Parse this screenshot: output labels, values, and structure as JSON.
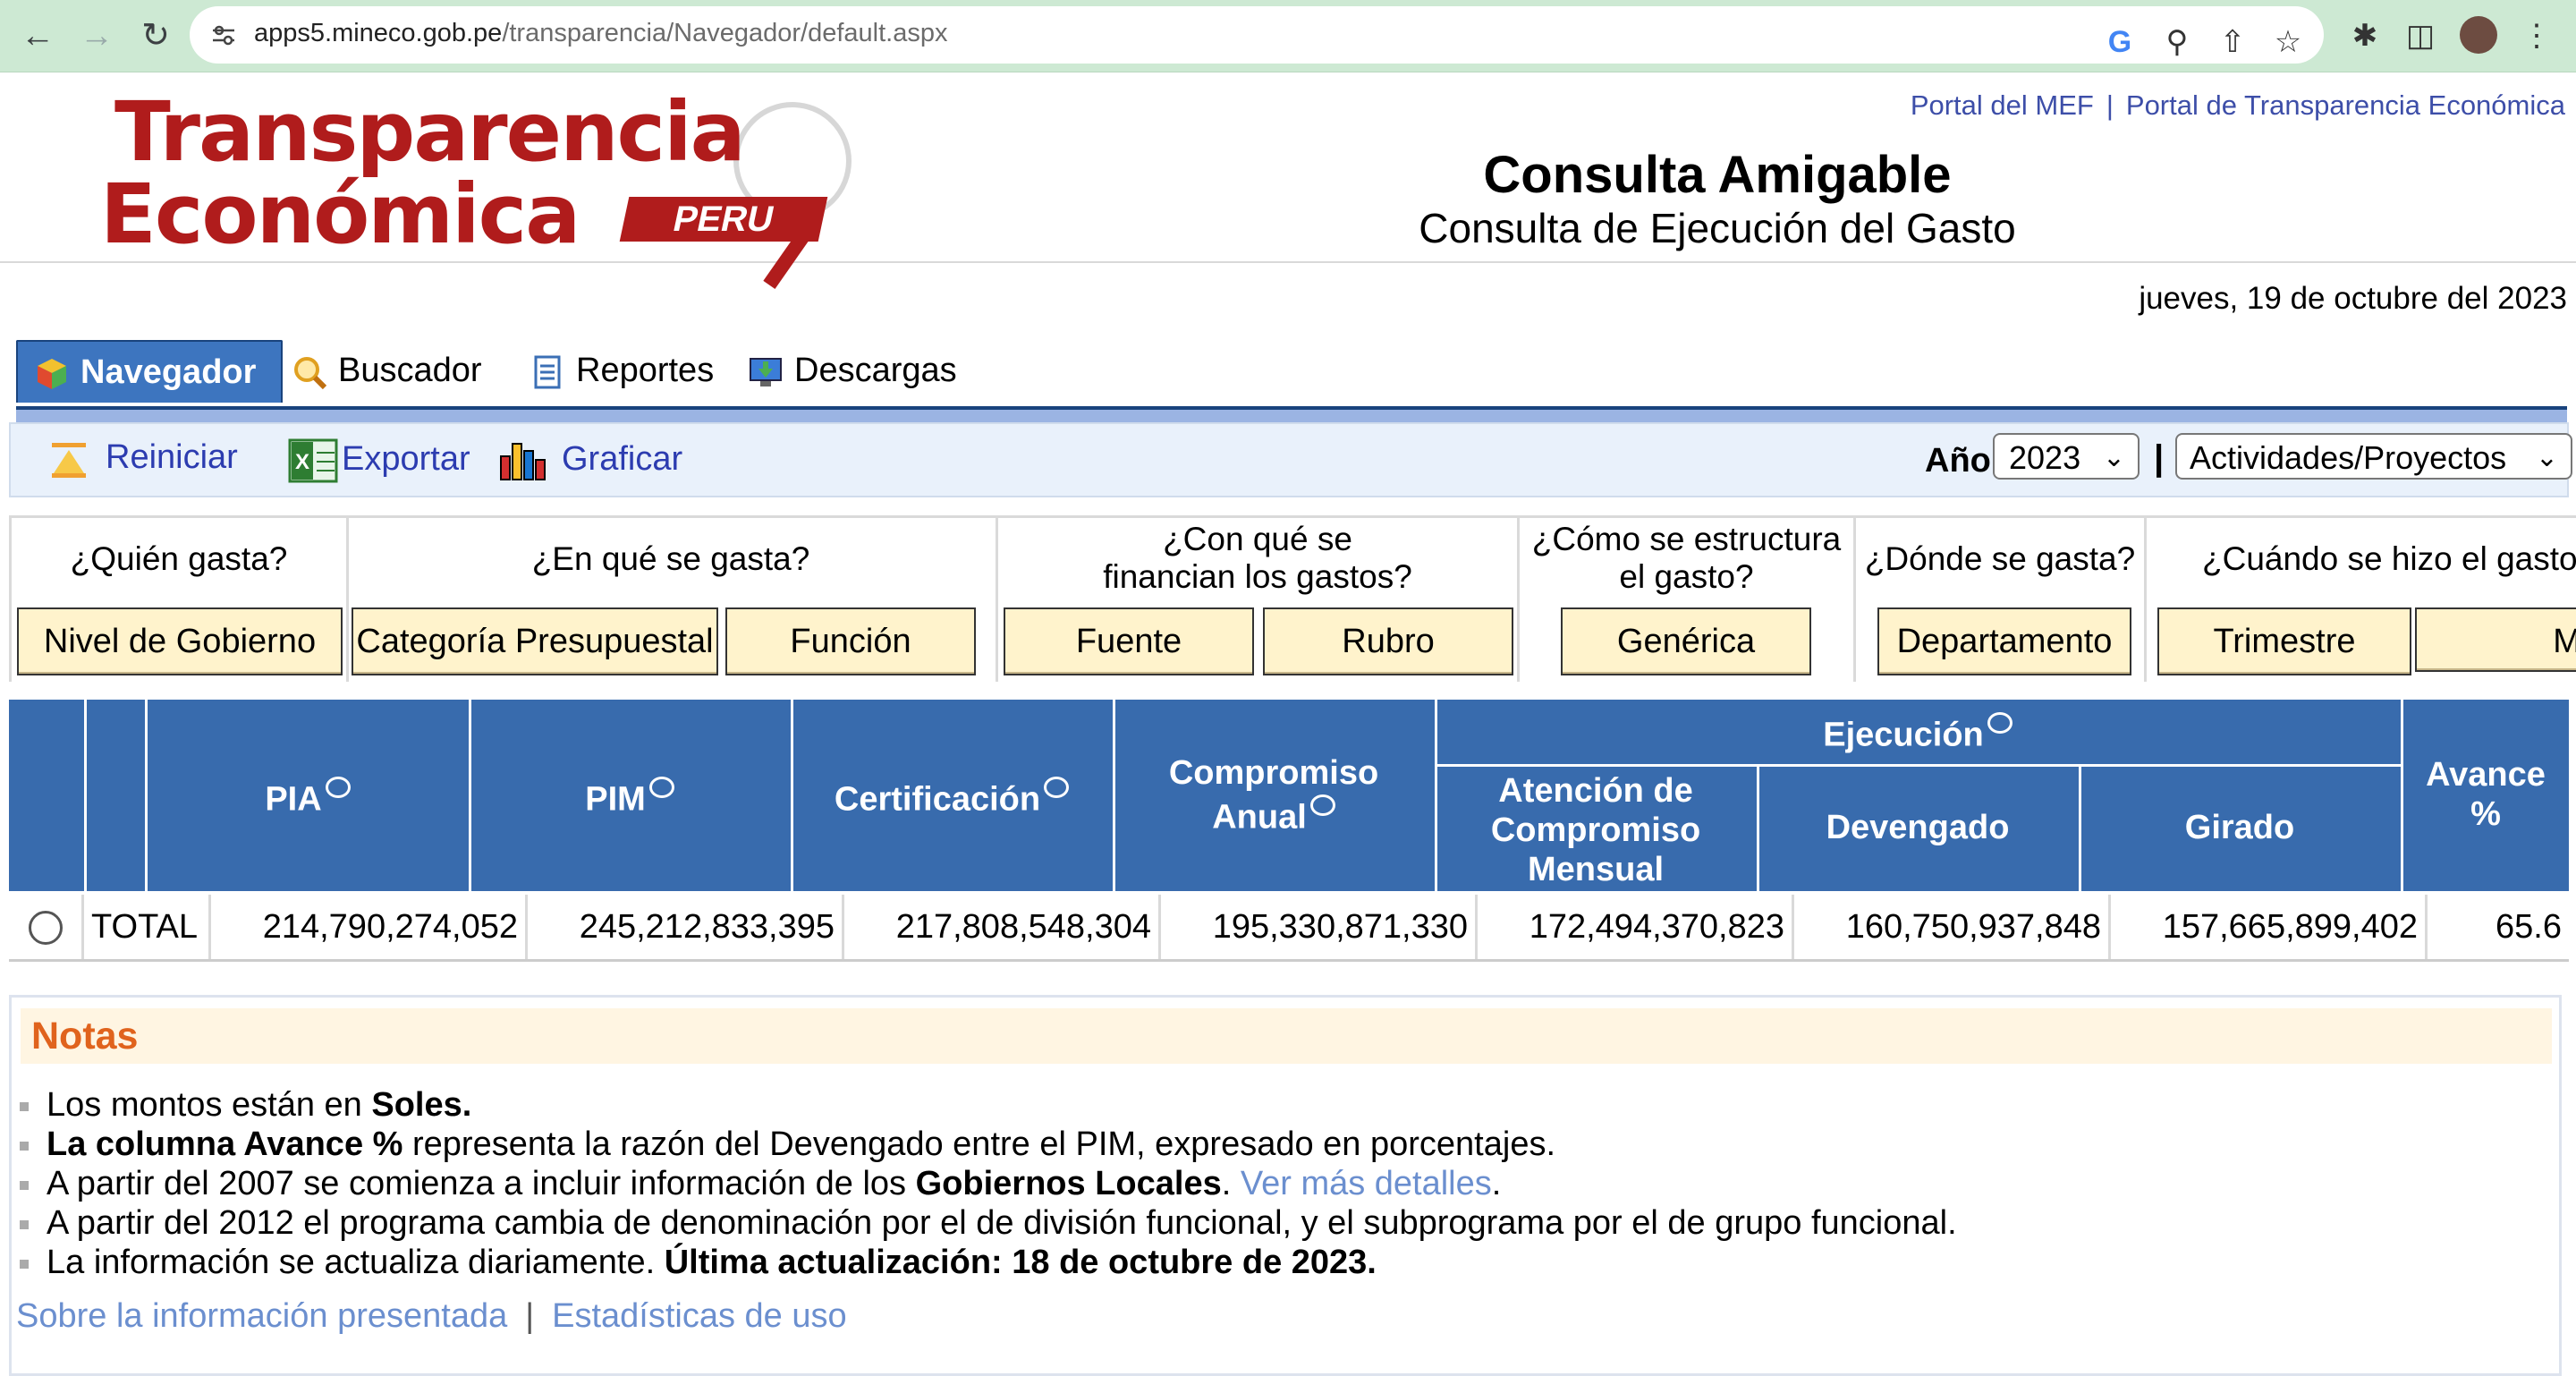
{
  "browser": {
    "url_domain": "apps5.mineco.gob.pe",
    "url_path": "/transparencia/Navegador/default.aspx"
  },
  "header": {
    "logo_line1": "Transparencia",
    "logo_line2": "Económica",
    "logo_peru": "PERU",
    "link_mef": "Portal del MEF",
    "link_sep": "|",
    "link_transparencia": "Portal de Transparencia Económica",
    "title": "Consulta Amigable",
    "subtitle": "Consulta de Ejecución del Gasto"
  },
  "date": "jueves, 19 de octubre del 2023",
  "tabs": [
    {
      "label": "Navegador",
      "icon": "cube-icon"
    },
    {
      "label": "Buscador",
      "icon": "magnifier-icon"
    },
    {
      "label": "Reportes",
      "icon": "report-icon"
    },
    {
      "label": "Descargas",
      "icon": "download-icon"
    }
  ],
  "toolbar": {
    "reset_label": "Reiniciar",
    "export_label": "Exportar",
    "chart_label": "Graficar",
    "year_label": "Año",
    "year_value": "2023",
    "pipe": "|",
    "type_value": "Actividades/Proyectos"
  },
  "questions": {
    "who": "¿Quién gasta?",
    "what": "¿En qué se gasta?",
    "funding_line1": "¿Con qué se",
    "funding_line2": "financian los gastos?",
    "structure_line1": "¿Cómo se estructura",
    "structure_line2": "el gasto?",
    "where": "¿Dónde se gasta?",
    "when": "¿Cuándo se hizo el gasto?",
    "btn_nivel": "Nivel de Gobierno",
    "btn_categoria": "Categoría Presupuestal",
    "btn_funcion": "Función",
    "btn_fuente": "Fuente",
    "btn_rubro": "Rubro",
    "btn_generica": "Genérica",
    "btn_departamento": "Departamento",
    "btn_trimestre": "Trimestre",
    "btn_mes": "Mes"
  },
  "table": {
    "headers": {
      "pia": "PIA",
      "pim": "PIM",
      "certificacion": "Certificación",
      "compromiso_line1": "Compromiso",
      "compromiso_line2": "Anual",
      "ejecucion": "Ejecución",
      "atencion_line1": "Atención de",
      "atencion_line2": "Compromiso",
      "atencion_line3": "Mensual",
      "devengado": "Devengado",
      "girado": "Girado",
      "avance_line1": "Avance",
      "avance_line2": "%"
    },
    "row": {
      "label": "TOTAL",
      "pia": "214,790,274,052",
      "pim": "245,212,833,395",
      "certificacion": "217,808,548,304",
      "compromiso": "195,330,871,330",
      "atencion": "172,494,370,823",
      "devengado": "160,750,937,848",
      "girado": "157,665,899,402",
      "avance": "65.6"
    }
  },
  "notes": {
    "title": "Notas",
    "n1_a": "Los montos están en ",
    "n1_b": "Soles.",
    "n2_a": "La columna Avance %",
    "n2_b": " representa la razón del Devengado entre el PIM, expresado en porcentajes.",
    "n3_a": "A partir del 2007 se comienza a incluir información de los ",
    "n3_b": "Gobiernos Locales",
    "n3_c": ". ",
    "n3_link": "Ver más detalles",
    "n3_d": ".",
    "n4": "A partir del 2012 el programa cambia de denominación por el de división funcional, y el subprograma por el de grupo funcional.",
    "n5_a": "La información se actualiza diariamente. ",
    "n5_b": "Última actualización: 18 de octubre de 2023.",
    "link_about": "Sobre la información presentada",
    "link_sep": "|",
    "link_stats": "Estadísticas de uso"
  }
}
